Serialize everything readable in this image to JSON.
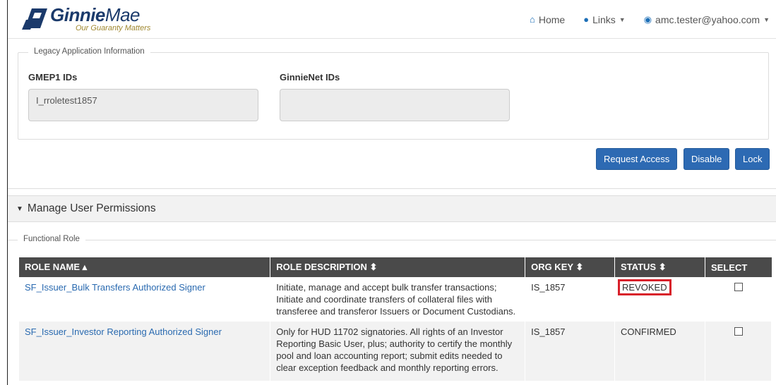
{
  "header": {
    "logo_bold": "Ginnie",
    "logo_light": "Mae",
    "tagline": "Our Guaranty Matters",
    "nav": {
      "home": "Home",
      "links": "Links",
      "user": "amc.tester@yahoo.com"
    }
  },
  "legacy": {
    "legend": "Legacy Application Information",
    "gmep1_label": "GMEP1 IDs",
    "gmep1_value": "I_rroletest1857",
    "ginnienet_label": "GinnieNet IDs",
    "ginnienet_value": ""
  },
  "actions": {
    "request_access": "Request Access",
    "disable": "Disable",
    "lock": "Lock"
  },
  "permissions": {
    "title": "Manage User Permissions",
    "legend": "Functional Role",
    "columns": [
      "ROLE NAME ▴",
      "ROLE DESCRIPTION ⬍",
      "ORG KEY ⬍",
      "STATUS ⬍",
      "SELECT"
    ],
    "rows": [
      {
        "role_name": "SF_Issuer_Bulk Transfers Authorized Signer",
        "description": "Initiate, manage and accept bulk transfer transactions; Initiate and coordinate transfers of collateral files with transferee and transferor Issuers or Document Custodians.",
        "org_key": "IS_1857",
        "status": "REVOKED",
        "selected": false
      },
      {
        "role_name": "SF_Issuer_Investor Reporting Authorized Signer",
        "description": "Only for HUD 11702 signatories. All rights of an Investor Reporting Basic User, plus; authority to certify the monthly pool and loan accounting report; submit edits needed to clear exception feedback and monthly reporting errors.",
        "org_key": "IS_1857",
        "status": "CONFIRMED",
        "selected": false
      }
    ]
  },
  "colors": {
    "primary_button": "#2d6ab3",
    "link": "#2a6ab0",
    "table_header": "#4a4a4a",
    "highlight": "#d8202a"
  }
}
